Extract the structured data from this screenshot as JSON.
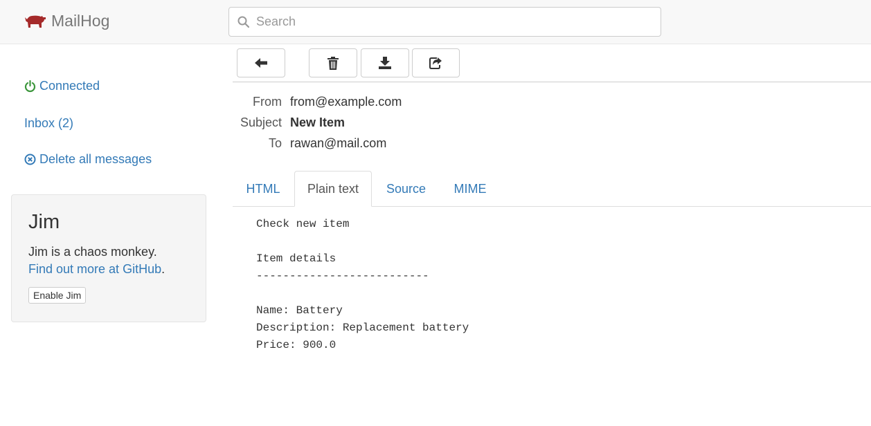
{
  "header": {
    "app_name": "MailHog",
    "search_placeholder": "Search"
  },
  "sidebar": {
    "connected": "Connected",
    "inbox": "Inbox (2)",
    "delete_all": "Delete all messages",
    "jim": {
      "title": "Jim",
      "description": "Jim is a chaos monkey.",
      "link": "Find out more at GitHub",
      "link_suffix": ".",
      "button": "Enable Jim"
    }
  },
  "toolbar": {
    "buttons": [
      "back-arrow-icon",
      "trash-icon",
      "download-icon",
      "share-icon"
    ]
  },
  "message": {
    "from_label": "From",
    "from": "from@example.com",
    "subject_label": "Subject",
    "subject": "New Item",
    "to_label": "To",
    "to": "rawan@mail.com",
    "tabs": [
      "HTML",
      "Plain text",
      "Source",
      "MIME"
    ],
    "active_tab": "Plain text",
    "body": "Check new item\n\nItem details\n--------------------------\n\nName: Battery\nDescription: Replacement battery\nPrice: 900.0"
  },
  "colors": {
    "link": "#337ab7",
    "brand": "#a52a2a",
    "connected": "#3c963c"
  }
}
